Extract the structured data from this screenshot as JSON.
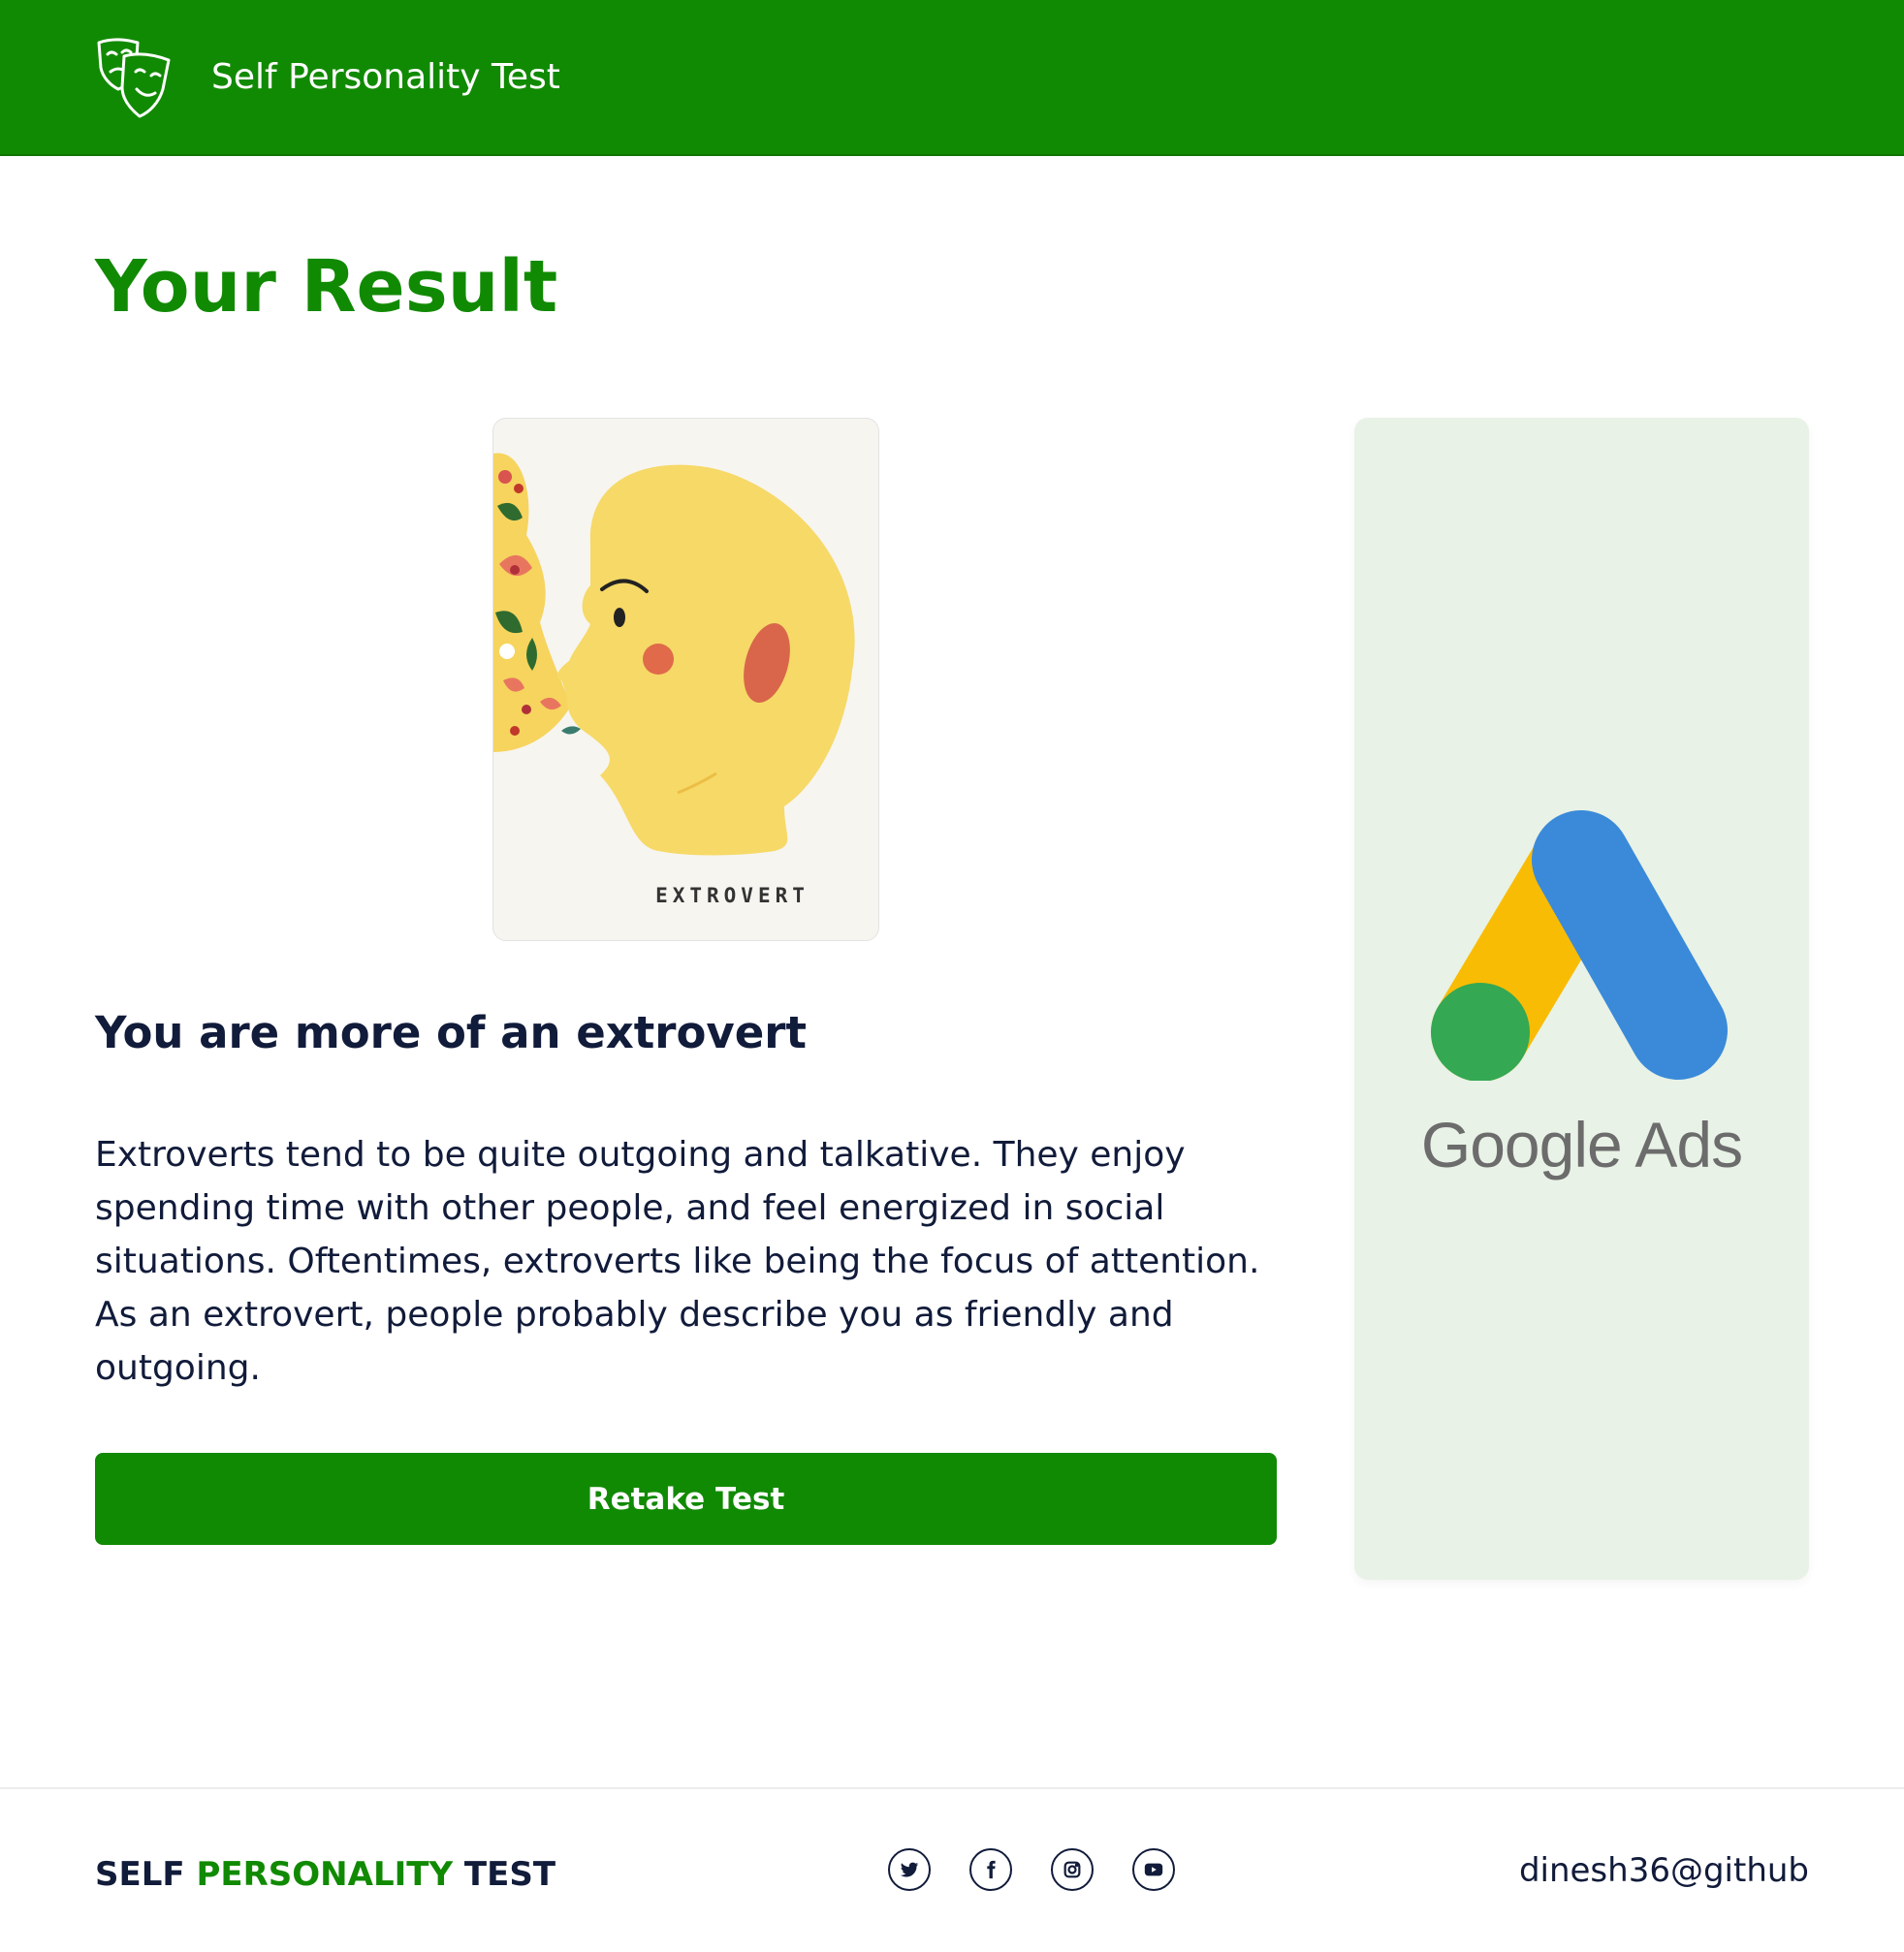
{
  "header": {
    "brand": "Self Personality Test",
    "logo_icon": "theater-masks-icon"
  },
  "page": {
    "title": "Your Result"
  },
  "result": {
    "card_label": "EXTROVERT",
    "heading": "You are more of an extrovert",
    "description": "Extroverts tend to be quite outgoing and talkative. They enjoy spending time with other people, and feel energized in social situations. Oftentimes, extroverts like being the focus of attention. As an extrovert, people probably describe you as friendly and outgoing.",
    "retake_label": "Retake Test"
  },
  "ad": {
    "text": "Google Ads",
    "colors": {
      "yellow": "#f9bc04",
      "blue": "#3b8ad9",
      "green": "#34a853"
    }
  },
  "footer": {
    "brand_word_1": "SELF",
    "brand_word_2": "PERSONALITY",
    "brand_word_3": "TEST",
    "credit": "dinesh36@github",
    "socials": [
      "twitter-icon",
      "facebook-icon",
      "instagram-icon",
      "youtube-icon"
    ]
  },
  "colors": {
    "primary": "#118a03",
    "text": "#111b3a",
    "ad_bg": "#e8f2e6"
  }
}
